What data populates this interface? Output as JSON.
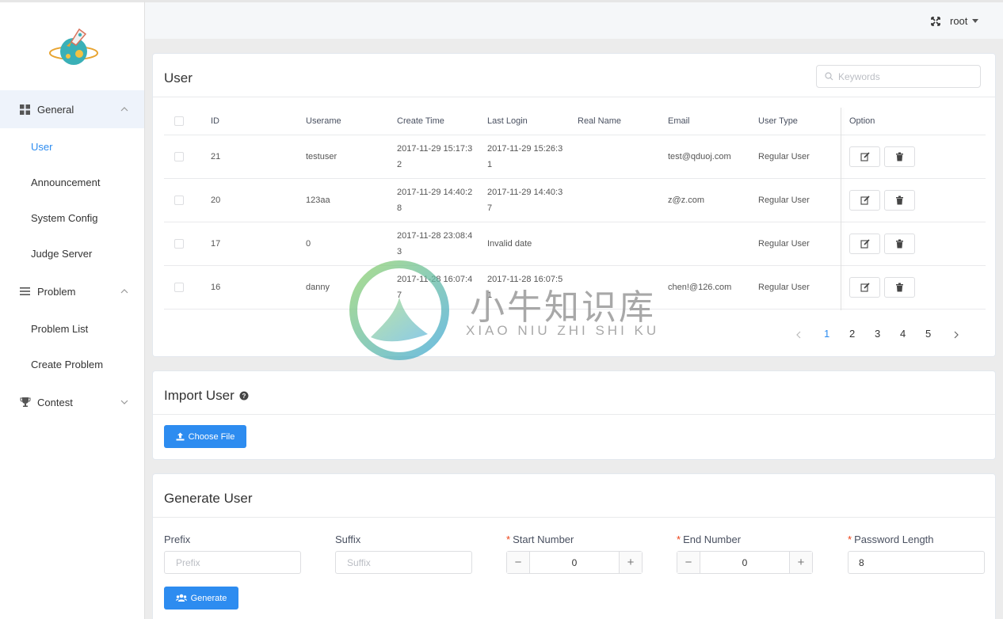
{
  "sidebar": {
    "groups": [
      {
        "label": "General",
        "items": [
          "User",
          "Announcement",
          "System Config",
          "Judge Server"
        ]
      },
      {
        "label": "Problem",
        "items": [
          "Problem List",
          "Create Problem"
        ]
      },
      {
        "label": "Contest",
        "items": []
      }
    ],
    "active_item": "User"
  },
  "header": {
    "username": "root"
  },
  "user_card": {
    "title": "User",
    "search_placeholder": "Keywords",
    "columns": [
      "ID",
      "Userame",
      "Create Time",
      "Last Login",
      "Real Name",
      "Email",
      "User Type",
      "Option"
    ],
    "rows": [
      {
        "id": "21",
        "username": "testuser",
        "create_time_1": "2017-11-29 15:17:3",
        "create_time_2": "2",
        "last_login_1": "2017-11-29 15:26:3",
        "last_login_2": "1",
        "real_name": "",
        "email": "test@qduoj.com",
        "user_type": "Regular User"
      },
      {
        "id": "20",
        "username": "123aa",
        "create_time_1": "2017-11-29 14:40:2",
        "create_time_2": "8",
        "last_login_1": "2017-11-29 14:40:3",
        "last_login_2": "7",
        "real_name": "",
        "email": "z@z.com",
        "user_type": "Regular User"
      },
      {
        "id": "17",
        "username": "0",
        "create_time_1": "2017-11-28 23:08:4",
        "create_time_2": "3",
        "last_login_1": "Invalid date",
        "last_login_2": "",
        "real_name": "",
        "email": "",
        "user_type": "Regular User"
      },
      {
        "id": "16",
        "username": "danny",
        "create_time_1": "2017-11-28 16:07:4",
        "create_time_2": "7",
        "last_login_1": "2017-11-28 16:07:5",
        "last_login_2": "1",
        "real_name": "",
        "email": "chen!@126.com",
        "user_type": "Regular User"
      }
    ],
    "pagination": {
      "pages": [
        "1",
        "2",
        "3",
        "4",
        "5"
      ],
      "current": "1"
    }
  },
  "import_card": {
    "title": "Import User",
    "choose_file_label": "Choose File"
  },
  "generate_card": {
    "title": "Generate User",
    "prefix_label": "Prefix",
    "prefix_placeholder": "Prefix",
    "suffix_label": "Suffix",
    "suffix_placeholder": "Suffix",
    "start_label": "Start Number",
    "start_value": "0",
    "end_label": "End Number",
    "end_value": "0",
    "pwlen_label": "Password Length",
    "pwlen_value": "8",
    "generate_label": "Generate"
  },
  "watermark": {
    "text": "小牛知识库",
    "sub": "XIAO NIU ZHI SHI KU"
  },
  "colors": {
    "accent": "#2d8cf0",
    "required": "#ed3f14"
  }
}
